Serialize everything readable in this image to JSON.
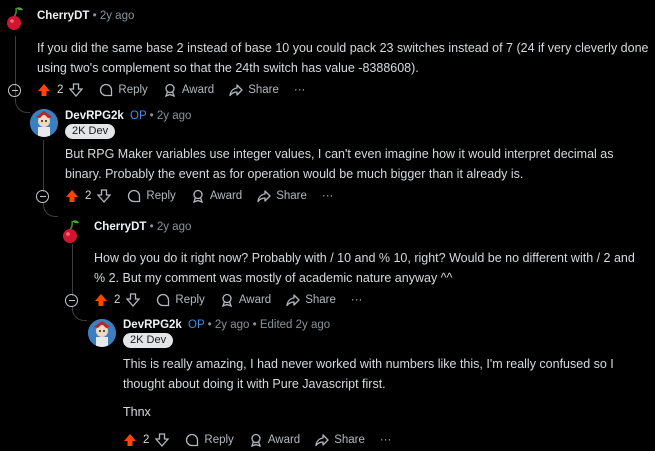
{
  "comments": [
    {
      "author": "CherryDT",
      "op_tag": "",
      "time": "2y ago",
      "edited": "",
      "flair": "",
      "avatar": "cherry-icon",
      "paragraphs": [
        "If you did the same base 2 instead of base 10 you could pack 23 switches instead of 7 (24 if very cleverly done using two's complement so that the 24th switch has value -8388608)."
      ],
      "votes": "2"
    },
    {
      "author": "DevRPG2k",
      "op_tag": "OP",
      "time": "2y ago",
      "edited": "",
      "flair": "2K Dev",
      "avatar": "devrpg-avatar-icon",
      "paragraphs": [
        "But RPG Maker variables use integer values, I can't even imagine how it would interpret decimal as binary. Probably the event as for operation would be much bigger than it already is."
      ],
      "votes": "2"
    },
    {
      "author": "CherryDT",
      "op_tag": "",
      "time": "2y ago",
      "edited": "",
      "flair": "",
      "avatar": "cherry-icon",
      "paragraphs": [
        "How do you do it right now? Probably with / 10 and % 10, right? Would be no different with / 2 and % 2. But my comment was mostly of academic nature anyway ^^"
      ],
      "votes": "2"
    },
    {
      "author": "DevRPG2k",
      "op_tag": "OP",
      "time": "2y ago",
      "edited": "Edited 2y ago",
      "flair": "2K Dev",
      "avatar": "devrpg-avatar-icon",
      "paragraphs": [
        "This is really amazing, I had never worked with numbers like this, I'm really confused so I thought about doing it with Pure Javascript first.",
        "Thnx"
      ],
      "votes": "2"
    }
  ],
  "labels": {
    "separator": "•",
    "reply": "Reply",
    "award": "Award",
    "share": "Share",
    "more": "···"
  },
  "colors": {
    "background": "#000000",
    "upvote_active": "#ff4500",
    "op_tag": "#3e8fe6",
    "flair_bg": "#e3e5e7"
  }
}
